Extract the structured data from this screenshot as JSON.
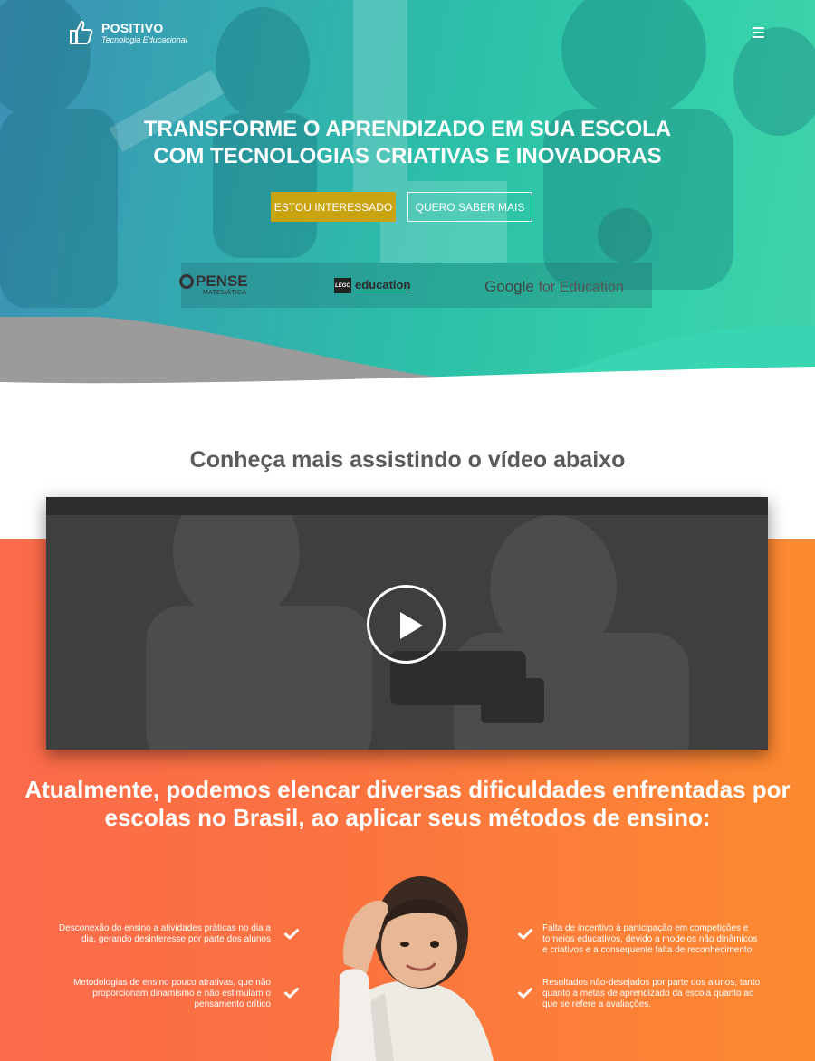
{
  "header": {
    "brand_name": "POSITIVO",
    "brand_sub": "Tecnologia Educacional",
    "menu_icon": "hamburger-icon"
  },
  "hero": {
    "title_line1": "TRANSFORME O APRENDIZADO EM SUA ESCOLA",
    "title_line2": "COM TECNOLOGIAS CRIATIVAS E INOVADORAS",
    "primary_button": "ESTOU INTERESSADO",
    "secondary_button": "QUERO SABER MAIS",
    "partners": {
      "pense": "PENSE",
      "pense_sub": "MATEMÁTICA",
      "lego_box": "LEGO",
      "lego": "education",
      "google": "Google",
      "google_ed": "for Education"
    }
  },
  "video_section": {
    "heading": "Conheça mais assistindo o vídeo abaixo",
    "play_icon": "play-icon"
  },
  "difficulties": {
    "heading_line1": "Atualmente, podemos elencar diversas dificuldades enfrentadas por",
    "heading_line2": "escolas no Brasil, ao aplicar seus métodos de ensino:",
    "left": [
      {
        "line1": "Desconexão do ensino a atividades práticas no dia a",
        "line2": "dia, gerando desinteresse por parte dos alunos",
        "line3": ""
      },
      {
        "line1": "Metodologias de ensino pouco atrativas, que não",
        "line2": "proporcionam dinamismo e não estimulam o",
        "line3": "pensamento crítico"
      }
    ],
    "right": [
      {
        "line1": "Falta de incentivo à participação em competições e",
        "line2": "torneios educativos, devido a modelos não dinâmicos",
        "line3": "e criativos e a consequente falta de reconhecimento"
      },
      {
        "line1": "Resultados não-desejados por parte dos alunos, tanto",
        "line2": "quanto a metas de aprendizado da escola quanto ao",
        "line3": "que se refere a avaliações."
      }
    ]
  },
  "colors": {
    "teal": "#33cfa9",
    "gold_button": "#c9a311",
    "orange": "#fb7440"
  }
}
